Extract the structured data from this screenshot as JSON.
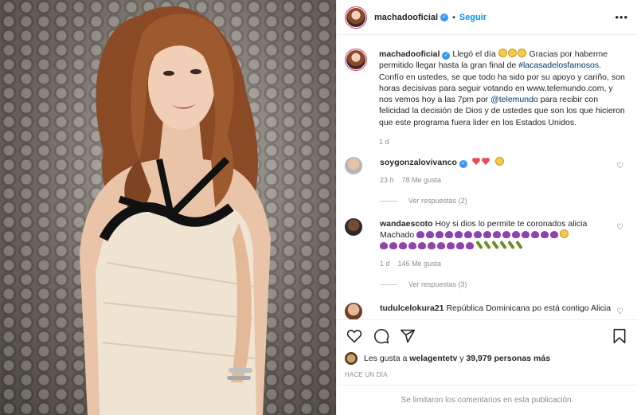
{
  "header": {
    "username": "machadooficial",
    "follow_label": "Seguir",
    "separator": "•"
  },
  "caption": {
    "username": "machadooficial",
    "text_1": "Llegó el día",
    "text_2": "Gracias por haberme permitido llegar hasta la gran final de",
    "hashtag": "#lacasadelosfamosos",
    "text_3": ". Confío en ustedes, se que todo ha sido por su apoyo y cariño, son horas decisivas para seguir votando en www.telemundo.com, y nos vemos hoy a las 7pm por",
    "mention": "@telemundo",
    "text_4": "para recibir con felicidad la decisión de Dios y de ustedes que son los que hicieron que este programa fuera lider en los Estados Unidos.",
    "age": "1 d"
  },
  "comments": [
    {
      "username": "soygonzalovivanco",
      "text": "",
      "age": "23 h",
      "likes": "78 Me gusta",
      "replies": "Ver respuestas (2)"
    },
    {
      "username": "wandaescoto",
      "text": "Hoy si dios lo permite te coronados alicia Machado",
      "age": "1 d",
      "likes": "146 Me gusta",
      "replies": "Ver respuestas (3)"
    },
    {
      "username": "tudulcelokura21",
      "text": "República Dominicana po está contigo Alicia"
    }
  ],
  "likes": {
    "prefix": "Les gusta a",
    "user": "welagentetv",
    "conj": "y",
    "count": "39,979 personas más"
  },
  "timestamp": "HACE UN DÍA",
  "comments_limited": "Se limitaron los comentarios en esta publicación.",
  "icons": [
    "heart-icon",
    "comment-icon",
    "share-icon",
    "bookmark-icon",
    "verified-icon",
    "more-options-icon"
  ],
  "colors": {
    "accent": "#0095f6",
    "verified": "#3897f0",
    "muted": "#8e8e8e",
    "like_red": "#ed4956"
  }
}
